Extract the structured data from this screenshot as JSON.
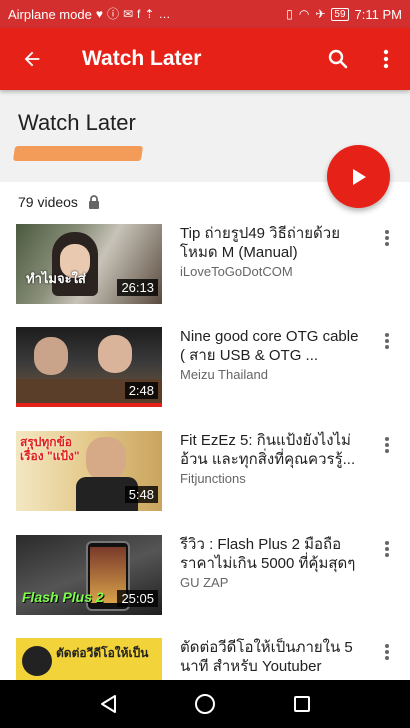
{
  "status_bar": {
    "left_text": "Airplane mode",
    "battery": "59",
    "time": "7:11 PM"
  },
  "app_bar": {
    "title": "Watch Later"
  },
  "playlist": {
    "title": "Watch Later",
    "video_count": "79 videos"
  },
  "videos": [
    {
      "title": "Tip ถ่ายรูป49 วิธีถ่ายด้วยโหมด M (Manual)",
      "channel": "iLoveToGoDotCOM",
      "duration": "26:13",
      "thumb_text": "ทำไมจะใส่",
      "progress": 0.0
    },
    {
      "title": "Nine good core OTG cable ( สาย USB & OTG ...",
      "channel": "Meizu Thailand",
      "duration": "2:48",
      "thumb_text": "",
      "progress": 1.0
    },
    {
      "title": "Fit EzEz 5: กินแป้งยังไงไม่อ้วน และทุกสิ่งที่คุณควรรู้...",
      "channel": "Fitjunctions",
      "duration": "5:48",
      "thumb_text": "สรุปทุกข้อเรื่อง \"แป้ง\"",
      "progress": 0.0
    },
    {
      "title": "รีวิว : Flash Plus 2 มือถือราคาไม่เกิน 5000 ที่คุ้มสุดๆ",
      "channel": "GU ZAP",
      "duration": "25:05",
      "thumb_text": "Flash Plus 2",
      "progress": 0.0
    },
    {
      "title": "ตัดต่อวีดีโอให้เป็นภายใน 5 นาที สำหรับ Youtuber",
      "channel": "",
      "duration": "",
      "thumb_text": "ตัดต่อวีดีโอให้เป็น",
      "progress": 0.0
    }
  ]
}
